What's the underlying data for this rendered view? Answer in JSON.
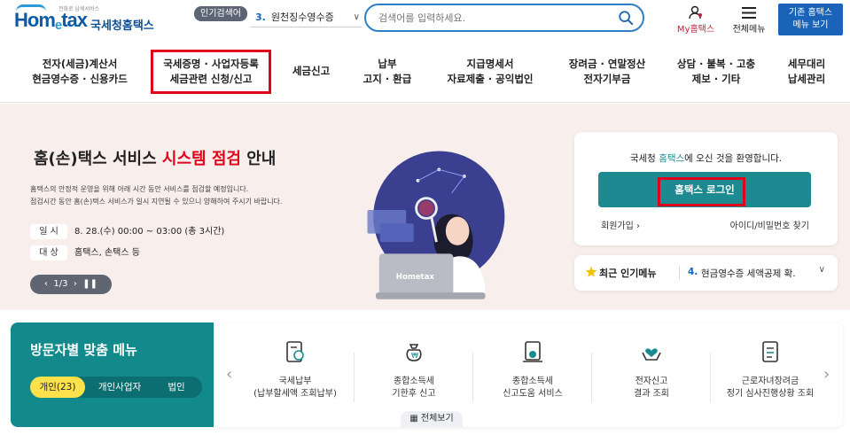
{
  "header": {
    "logo_text": "Hometax",
    "logo_small": "전화로 납세서비스",
    "logo_kor": "국세청홈택스",
    "popular_tag": "인기검색어",
    "rank_num": "3.",
    "rank_text": "원천징수영수증",
    "search_placeholder": "검색어를 입력하세요.",
    "my_hometax": "My홈택스",
    "all_menu": "전체메뉴",
    "legacy_button": "기존 홈택스\n메뉴 보기"
  },
  "nav": {
    "items": [
      "전자(세금)계산서\n현금영수증 · 신용카드",
      "국세증명 · 사업자등록\n세금관련 신청/신고",
      "세금신고",
      "납부\n고지 · 환급",
      "지급명세서\n자료제출 · 공익법인",
      "장려금 · 연말정산\n전자기부금",
      "상담 · 불복 · 고충\n제보 · 기타",
      "세무대리\n납세관리"
    ]
  },
  "hero": {
    "title_1": "홈(손)택스 서비스 ",
    "title_red": "시스템 점검",
    "title_2": " 안내",
    "desc": "홈택스의 안정적 운영을 위해 아래 시간 동안 서비스를 점검할 예정입니다.\n점검시간 동안 홈(손)택스 서비스가 일시 지연될 수 있으니 양해하여 주시기 바랍니다.",
    "date_tag": "일 시",
    "date_value": "8. 28.(수) 00:00 ~ 03:00 (총 3시간)",
    "target_tag": "대 상",
    "target_value": "홈택스, 손택스 등",
    "pager": "1/3"
  },
  "login": {
    "welcome_1": "국세청 ",
    "welcome_teal": "홈택스",
    "welcome_2": "에 오신 것을 환영합니다.",
    "login_button": "홈택스 로그인",
    "join": "회원가입",
    "find": "아이디/비밀번호 찾기"
  },
  "popular": {
    "title": "최근 인기메뉴",
    "num": "4.",
    "value": "현금영수증 세액공제 확."
  },
  "visitor": {
    "title": "방문자별 맞춤 메뉴",
    "tabs": [
      "개인(23)",
      "개인사업자",
      "법인"
    ]
  },
  "services": [
    "국세납부\n(납부할세액 조회납부)",
    "종합소득세\n기한후 신고",
    "종합소득세\n신고도움 서비스",
    "전자신고\n결과 조회",
    "근로자녀장려금\n정기 심사진행상황 조회"
  ],
  "view_all": "전체보기",
  "colors": {
    "brand_blue": "#1a63b8",
    "teal": "#1d8a92",
    "highlight_red": "#e0001b",
    "hero_bg": "#f8eeec"
  }
}
